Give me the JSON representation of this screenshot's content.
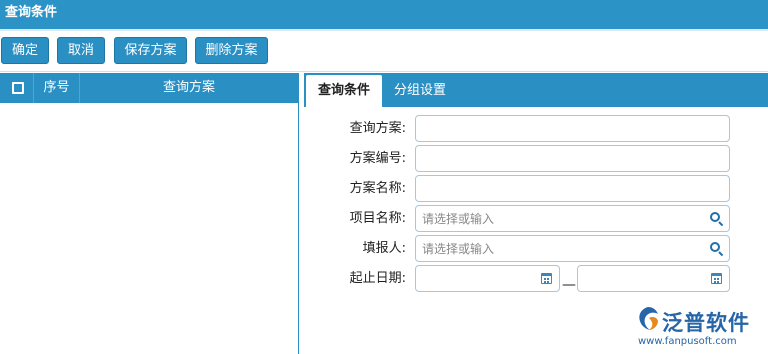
{
  "window": {
    "title": "查询条件"
  },
  "toolbar": {
    "buttons": [
      {
        "label": "确定"
      },
      {
        "label": "取消"
      },
      {
        "label": "保存方案"
      },
      {
        "label": "删除方案"
      }
    ]
  },
  "plan_grid": {
    "columns": [
      "序号",
      "查询方案"
    ]
  },
  "tabs": [
    {
      "label": "查询条件",
      "active": true
    },
    {
      "label": "分组设置",
      "active": false
    }
  ],
  "form": {
    "fields": [
      {
        "label": "查询方案:",
        "value": "",
        "placeholder": ""
      },
      {
        "label": "方案编号:",
        "value": "",
        "placeholder": ""
      },
      {
        "label": "方案名称:",
        "value": "",
        "placeholder": ""
      },
      {
        "label": "项目名称:",
        "value": "",
        "placeholder": "请选择或输入"
      },
      {
        "label": "填报人:",
        "value": "",
        "placeholder": "请选择或输入"
      },
      {
        "label": "起止日期:",
        "start": "",
        "end": "",
        "separator": "—"
      }
    ]
  },
  "branding": {
    "name": "泛普软件",
    "url": "www.fanpusoft.com"
  },
  "icons": {
    "search": "search-icon",
    "calendar": "calendar-icon",
    "checkbox": "checkbox-icon"
  },
  "colors": {
    "primary": "#2a8fc3",
    "titlebar": "#2c93c7",
    "field_border": "#a9c7da",
    "brand": "#2565a8"
  }
}
